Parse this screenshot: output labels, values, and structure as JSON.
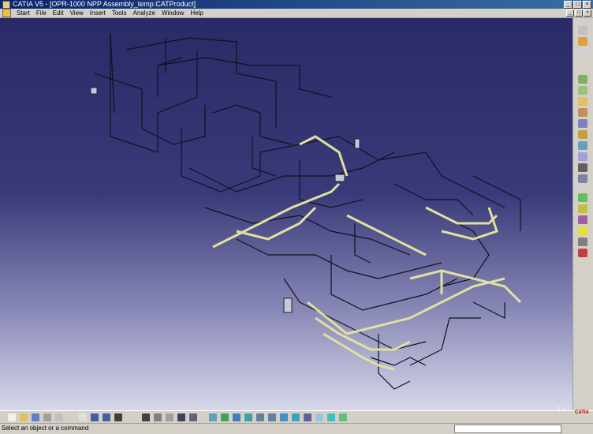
{
  "window": {
    "title": "CATIA V5 - [OPR-1000 NPP Assembly_temp.CATProduct]",
    "buttons": [
      "_",
      "□",
      "×"
    ]
  },
  "menu": {
    "items": [
      "Start",
      "File",
      "Edit",
      "View",
      "Insert",
      "Tools",
      "Analyze",
      "Window",
      "Help"
    ]
  },
  "doc_buttons": [
    "_",
    "□",
    "×"
  ],
  "viewport": {
    "background_top": "#2a2a66",
    "background_bottom": "#d8d8ea",
    "pipe_color": "#e0e0a0",
    "line_color": "#101020"
  },
  "right_toolbar": {
    "icons": [
      "product-icon",
      "select-icon",
      "swap-icon",
      "component-icon",
      "existing-component-icon",
      "part-icon",
      "replace-icon",
      "reorder-icon",
      "numbering-icon",
      "multi-instantiate-icon",
      "fast-multi-instantiate-icon",
      "constraint-icon",
      "coincidence-icon",
      "contact-icon",
      "offset-icon",
      "angle-icon",
      "fix-icon",
      "explode-icon",
      "update-icon"
    ]
  },
  "bottom_toolbar": {
    "icons": [
      "new-icon",
      "open-icon",
      "save-icon",
      "print-icon",
      "cut-icon",
      "copy-icon",
      "paste-icon",
      "undo-icon",
      "redo-icon",
      "whats-this-icon",
      "formula-icon",
      "measure-icon",
      "catalog-icon",
      "hide-show-icon",
      "swap-visible-icon",
      "fly-icon",
      "fit-all-icon",
      "pan-icon",
      "rotate-icon",
      "zoom-in-icon",
      "zoom-out-icon",
      "normal-view-icon",
      "iso-view-icon",
      "view-mode-icon",
      "shading-icon",
      "hide-icon",
      "show-icon"
    ]
  },
  "status": {
    "text": "Select an object or a command",
    "command_value": ""
  },
  "logo": {
    "text": "CATIA"
  }
}
